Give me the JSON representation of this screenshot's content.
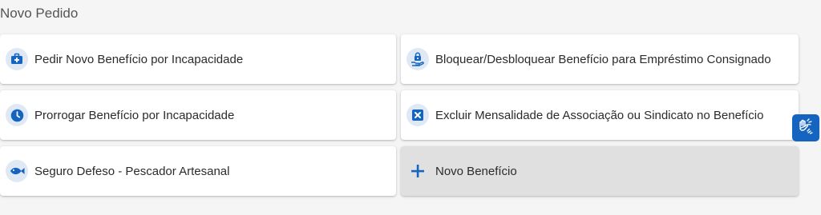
{
  "page": {
    "title": "Novo Pedido"
  },
  "options": [
    {
      "label": "Pedir Novo Benefício por Incapacidade",
      "icon": "medical-kit-icon"
    },
    {
      "label": "Bloquear/Desbloquear Benefício para Empréstimo Consignado",
      "icon": "hand-lock-icon"
    },
    {
      "label": "Prorrogar Benefício por Incapacidade",
      "icon": "clock-icon"
    },
    {
      "label": "Excluir Mensalidade de Associação ou Sindicato no Benefício",
      "icon": "close-box-icon"
    },
    {
      "label": "Seguro Defeso - Pescador Artesanal",
      "icon": "fish-icon"
    },
    {
      "label": "Novo Benefício",
      "icon": "plus-icon"
    }
  ],
  "accessibility": {
    "icon": "sign-language-hands-icon"
  },
  "colors": {
    "accent": "#1565c0",
    "icon_bg": "#dfe8f5",
    "page_bg": "#f5f5f5",
    "card_alt_bg": "#e0e0e0"
  }
}
